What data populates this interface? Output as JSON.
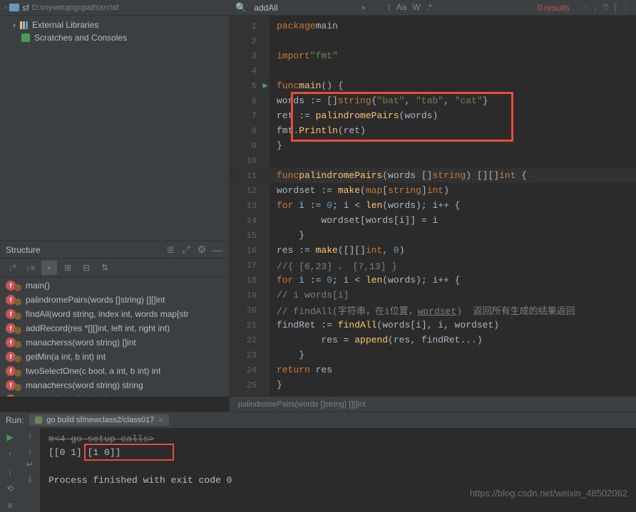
{
  "project": {
    "name": "sf",
    "path": "D:\\mysetup\\gopath\\src\\sf",
    "tree": [
      {
        "label": "External Libraries",
        "icon": "lib"
      },
      {
        "label": "Scratches and Consoles",
        "icon": "scratch"
      }
    ]
  },
  "search": {
    "query": "addAll",
    "results": "0 results",
    "opts": [
      "Aa",
      "W",
      ".*"
    ]
  },
  "structure": {
    "title": "Structure",
    "items": [
      "main()",
      "palindromePairs(words []string) [][]int",
      "findAll(word string, index int, words map[str",
      "addRecord(res *[][]int, left int, right int)",
      "manacherss(word string) []int",
      "getMin(a int, b int) int",
      "twoSelectOne(c bool, a int, b int) int",
      "manachercs(word string) string",
      "reverse(str string) string"
    ]
  },
  "code": {
    "lines": [
      1,
      2,
      3,
      4,
      5,
      6,
      7,
      8,
      9,
      10,
      11,
      12,
      13,
      14,
      15,
      16,
      17,
      18,
      19,
      20,
      21,
      22,
      23,
      24,
      25
    ],
    "status": "palindromePairs(words []string) [][]int"
  },
  "run": {
    "label": "Run:",
    "tab": "go build sf/newclass2/class017",
    "setup": "m<4 go setup calls>",
    "output": "[[0 1] [1 0]]",
    "exit": "Process finished with exit code 0"
  },
  "watermark": "https://blog.csdn.net/weixin_48502062"
}
